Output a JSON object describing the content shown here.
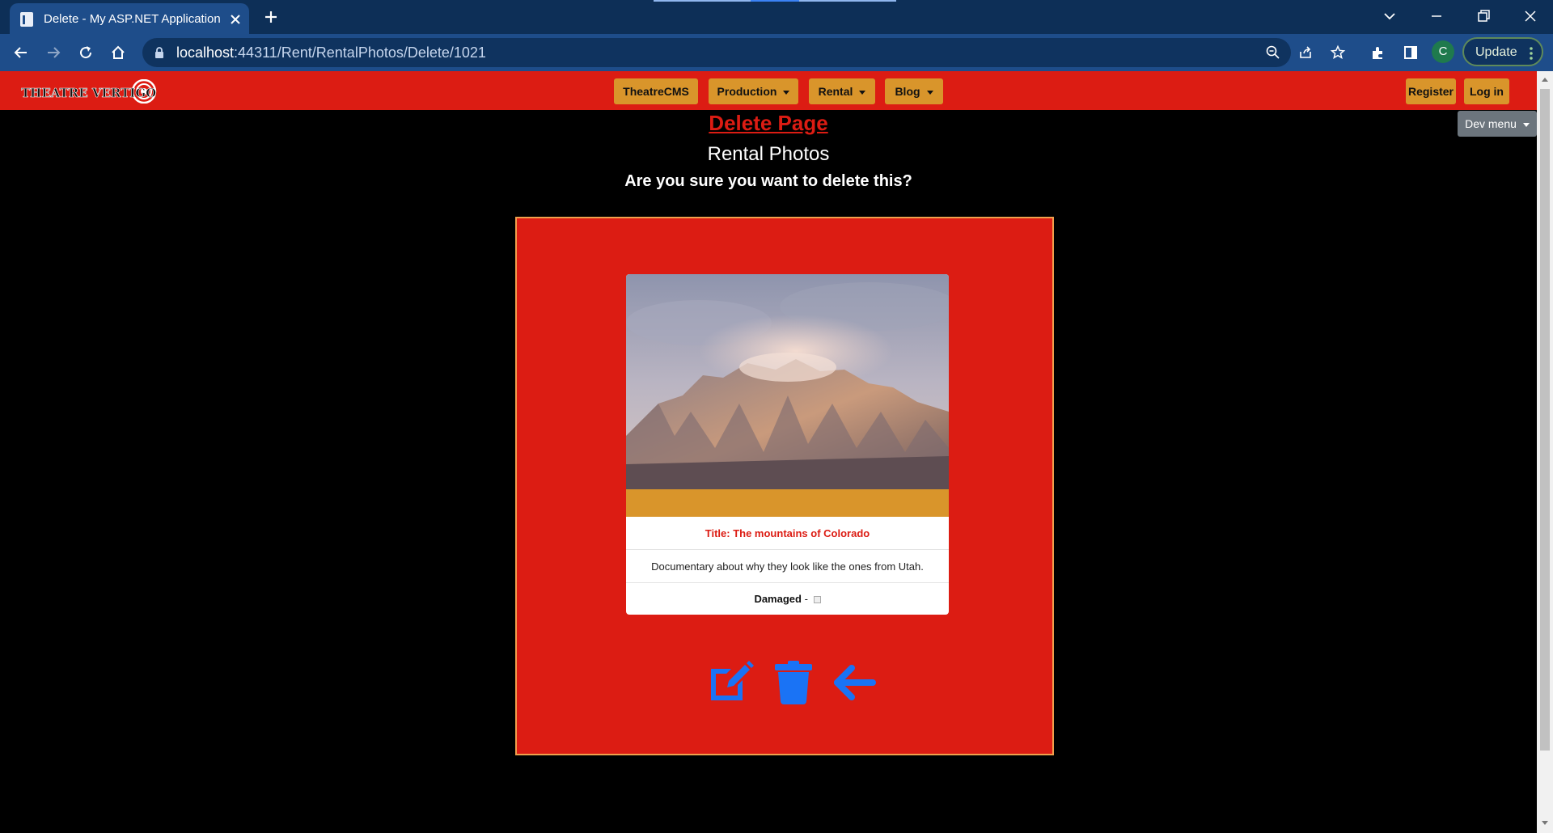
{
  "browser": {
    "tab_title": "Delete - My ASP.NET Application",
    "url_host": "localhost",
    "url_rest": ":44311/Rent/RentalPhotos/Delete/1021",
    "profile_initial": "C",
    "update_label": "Update"
  },
  "navbar": {
    "logo_text": "THEATRE VERTIGO",
    "items": [
      {
        "label": "TheatreCMS",
        "dropdown": false
      },
      {
        "label": "Production",
        "dropdown": true
      },
      {
        "label": "Rental",
        "dropdown": true
      },
      {
        "label": "Blog",
        "dropdown": true
      }
    ],
    "register_label": "Register",
    "login_label": "Log in",
    "dev_menu_label": "Dev menu"
  },
  "page": {
    "heading": "Delete Page",
    "subheading": "Rental Photos",
    "confirm_text": "Are you sure you want to delete this?"
  },
  "card": {
    "title": "Title: The mountains of Colorado",
    "description": "Documentary about why they look like the ones from Utah.",
    "damaged_label": "Damaged",
    "damaged_separator": "-",
    "damaged_checked": false
  },
  "actions": {
    "edit_icon": "edit-icon",
    "delete_icon": "trash-icon",
    "back_icon": "arrow-left-icon"
  },
  "colors": {
    "navbar_red": "#dc1c13",
    "nav_button_gold": "#d9952b",
    "action_blue": "#1a73f5"
  }
}
